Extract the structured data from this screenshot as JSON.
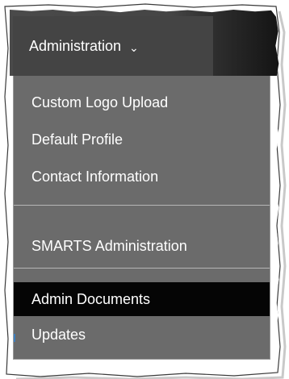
{
  "nav": {
    "tab_label": "Administration",
    "caret_icon": "chevron-down-icon"
  },
  "menu": {
    "items": [
      {
        "label": "Custom Logo Upload",
        "selected": false
      },
      {
        "label": "Default Profile",
        "selected": false
      },
      {
        "label": "Contact Information",
        "selected": false
      },
      {
        "label": "SMARTS Administration",
        "selected": false
      },
      {
        "label": "Admin Documents",
        "selected": true
      },
      {
        "label": "Updates",
        "selected": false
      }
    ]
  },
  "colors": {
    "nav_background": "#444444",
    "menu_background": "#6b6b6b",
    "selected_item_background": "#050505",
    "text": "#ffffff"
  }
}
